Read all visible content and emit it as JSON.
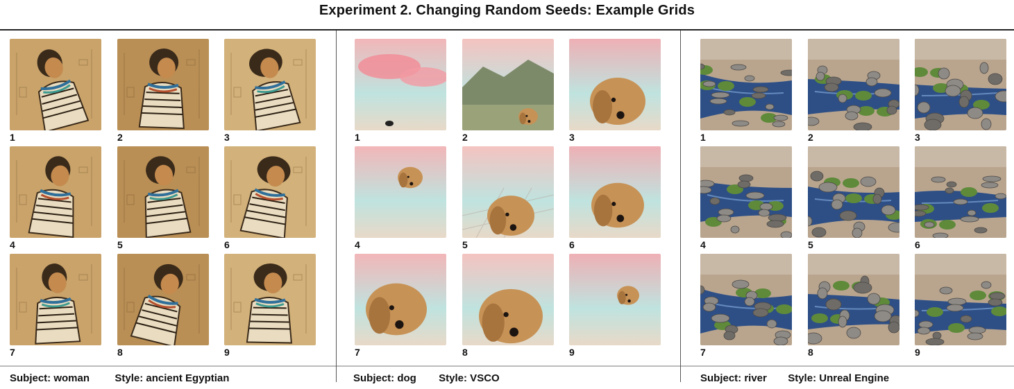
{
  "title": "Experiment 2. Changing Random Seeds: Example Grids",
  "panels": [
    {
      "subject_label": "Subject: woman",
      "style_label": "Style: ancient Egyptian",
      "images": [
        {
          "number": "1"
        },
        {
          "number": "2"
        },
        {
          "number": "3"
        },
        {
          "number": "4"
        },
        {
          "number": "5"
        },
        {
          "number": "6"
        },
        {
          "number": "7"
        },
        {
          "number": "8"
        },
        {
          "number": "9"
        }
      ]
    },
    {
      "subject_label": "Subject: dog",
      "style_label": "Style: VSCO",
      "images": [
        {
          "number": "1"
        },
        {
          "number": "2"
        },
        {
          "number": "3"
        },
        {
          "number": "4"
        },
        {
          "number": "5"
        },
        {
          "number": "6"
        },
        {
          "number": "7"
        },
        {
          "number": "8"
        },
        {
          "number": "9"
        }
      ]
    },
    {
      "subject_label": "Subject: river",
      "style_label": "Style: Unreal Engine",
      "images": [
        {
          "number": "1"
        },
        {
          "number": "2"
        },
        {
          "number": "3"
        },
        {
          "number": "4"
        },
        {
          "number": "5"
        },
        {
          "number": "6"
        },
        {
          "number": "7"
        },
        {
          "number": "8"
        },
        {
          "number": "9"
        }
      ]
    }
  ]
}
